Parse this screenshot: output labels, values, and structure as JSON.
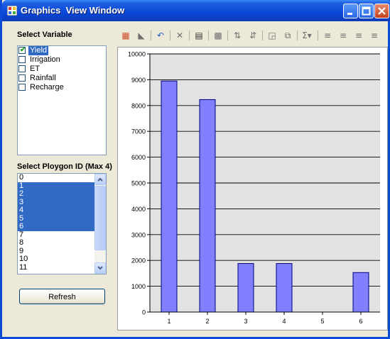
{
  "window": {
    "title": "Graphics  View Window"
  },
  "variables": {
    "label": "Select Variable",
    "items": [
      {
        "label": "Yield",
        "checked": true,
        "selected": true
      },
      {
        "label": "Irrigation",
        "checked": false,
        "selected": false
      },
      {
        "label": "ET",
        "checked": false,
        "selected": false
      },
      {
        "label": "Rainfall",
        "checked": false,
        "selected": false
      },
      {
        "label": "Recharge",
        "checked": false,
        "selected": false
      }
    ]
  },
  "polygons": {
    "label": "Select Ploygon ID (Max 4)",
    "items": [
      {
        "label": "0",
        "selected": false
      },
      {
        "label": "1",
        "selected": true
      },
      {
        "label": "2",
        "selected": true
      },
      {
        "label": "3",
        "selected": true
      },
      {
        "label": "4",
        "selected": true
      },
      {
        "label": "5",
        "selected": true
      },
      {
        "label": "6",
        "selected": true
      },
      {
        "label": "7",
        "selected": false
      },
      {
        "label": "8",
        "selected": false
      },
      {
        "label": "9",
        "selected": false
      },
      {
        "label": "10",
        "selected": false
      },
      {
        "label": "11",
        "selected": false
      }
    ]
  },
  "refresh_label": "Refresh",
  "toolbar_icons": [
    "chart-type-icon",
    "area-chart-icon",
    "undo-icon",
    "delete-icon",
    "data-grid-icon",
    "legend-icon",
    "sort-ascending-icon",
    "sort-descending-icon",
    "properties-icon",
    "copy-icon",
    "sum-icon",
    "align-left-icon",
    "align-center-icon",
    "align-right-icon"
  ],
  "colors": {
    "bar_fill": "#8080ff",
    "bar_stroke": "#000080",
    "plot_bg": "#e2e2e2",
    "selection": "#316ac5",
    "title_bar": "#0a48d8"
  },
  "chart_data": {
    "type": "bar",
    "categories": [
      "1",
      "2",
      "3",
      "4",
      "5",
      "6"
    ],
    "values": [
      8950,
      8230,
      1880,
      1880,
      0,
      1530
    ],
    "ylim": [
      0,
      10000
    ],
    "yticks": [
      0,
      1000,
      2000,
      3000,
      4000,
      5000,
      6000,
      7000,
      8000,
      9000,
      10000
    ],
    "grid": true,
    "title": "",
    "xlabel": "",
    "ylabel": ""
  }
}
